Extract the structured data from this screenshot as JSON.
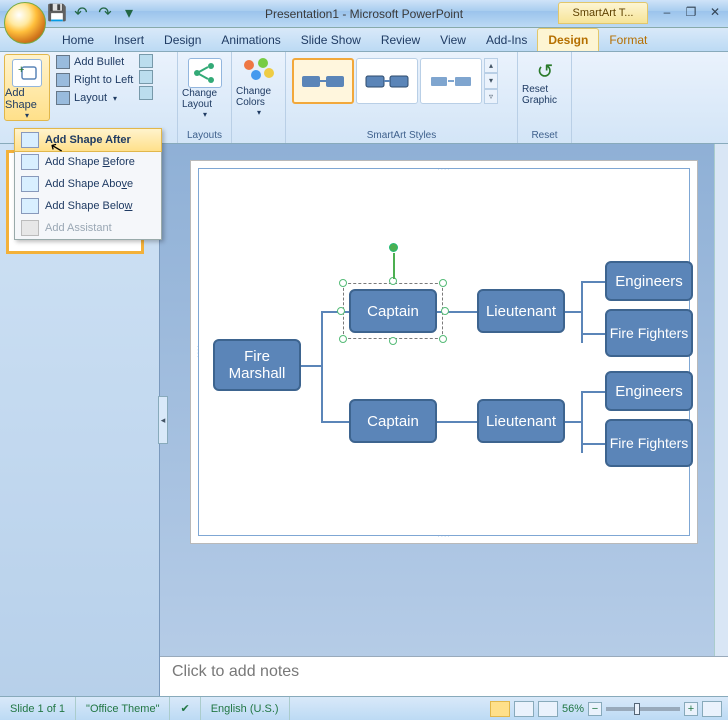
{
  "app": {
    "title": "Presentation1 - Microsoft PowerPoint",
    "context_tool": "SmartArt T..."
  },
  "window_controls": {
    "min": "–",
    "restore": "❐",
    "close": "✕"
  },
  "qat": {
    "save": "💾",
    "undo": "↶",
    "redo": "↷",
    "more": "▾"
  },
  "tabs": {
    "home": "Home",
    "insert": "Insert",
    "design": "Design",
    "animations": "Animations",
    "slideshow": "Slide Show",
    "review": "Review",
    "view": "View",
    "addins": "Add-Ins",
    "ctx_design": "Design",
    "ctx_format": "Format"
  },
  "ribbon": {
    "create_graphic": {
      "label": "",
      "add_shape": "Add Shape",
      "add_bullet": "Add Bullet",
      "rtl": "Right to Left",
      "layout": "Layout"
    },
    "layouts": {
      "label": "Layouts",
      "change_layout": "Change Layout"
    },
    "colors": {
      "label": "",
      "change_colors": "Change Colors"
    },
    "styles": {
      "label": "SmartArt Styles"
    },
    "reset": {
      "label": "Reset",
      "reset_graphic": "Reset Graphic"
    }
  },
  "dropdown": {
    "after": "Add Shape After",
    "before_pre": "Add Shape ",
    "before_u": "B",
    "before_post": "efore",
    "above_pre": "Add Shape Abo",
    "above_u": "v",
    "above_post": "e",
    "below_pre": "Add Shape Belo",
    "below_u": "w",
    "below_post": "",
    "assistant": "Add Assistant"
  },
  "chart_data": {
    "type": "hierarchy",
    "root": "Fire Marshall",
    "children": [
      {
        "name": "Captain",
        "children": [
          {
            "name": "Lieutenant",
            "children": [
              {
                "name": "Engineers"
              },
              {
                "name": "Fire Fighters"
              }
            ]
          }
        ]
      },
      {
        "name": "Captain",
        "children": [
          {
            "name": "Lieutenant",
            "children": [
              {
                "name": "Engineers"
              },
              {
                "name": "Fire Fighters"
              }
            ]
          }
        ]
      }
    ],
    "selected_node": "Captain"
  },
  "nodes": {
    "root": "Fire Marshall",
    "cap1": "Captain",
    "lt1": "Lieutenant",
    "eng1": "Engineers",
    "ff1": "Fire Fighters",
    "cap2": "Captain",
    "lt2": "Lieutenant",
    "eng2": "Engineers",
    "ff2": "Fire Fighters"
  },
  "notes_placeholder": "Click to add notes",
  "status": {
    "slide": "Slide 1 of 1",
    "theme": "\"Office Theme\"",
    "lang": "English (U.S.)",
    "zoom": "56%"
  },
  "colors": {
    "node_fill": "#5b85b8",
    "node_border": "#3d648f",
    "highlight": "#ffe08a"
  }
}
